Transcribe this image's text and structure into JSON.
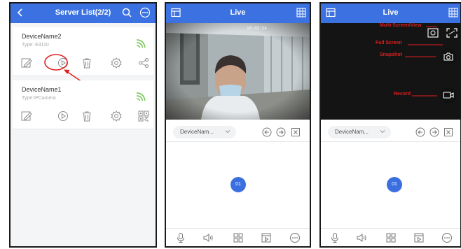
{
  "screen1": {
    "title": "Server List(2/2)",
    "devices": [
      {
        "name": "DeviceName2",
        "type": "Type: E3110"
      },
      {
        "name": "DeviceName1",
        "type": "Type:IPCamera"
      }
    ]
  },
  "screen2": {
    "title": "Live",
    "device_select": "DeviceNam...",
    "page_badge": "01",
    "timestamp": "10:42:24"
  },
  "screen3": {
    "title": "Live",
    "device_select": "DeviceNam...",
    "page_badge": "01",
    "annotations": {
      "unknown_top": "Multi Screen/View",
      "full_screen": "Full Screen",
      "snapshot": "Snapshot",
      "record": "Record"
    }
  },
  "colors": {
    "accent": "#3b71e0",
    "annotation": "#e01e1e"
  }
}
